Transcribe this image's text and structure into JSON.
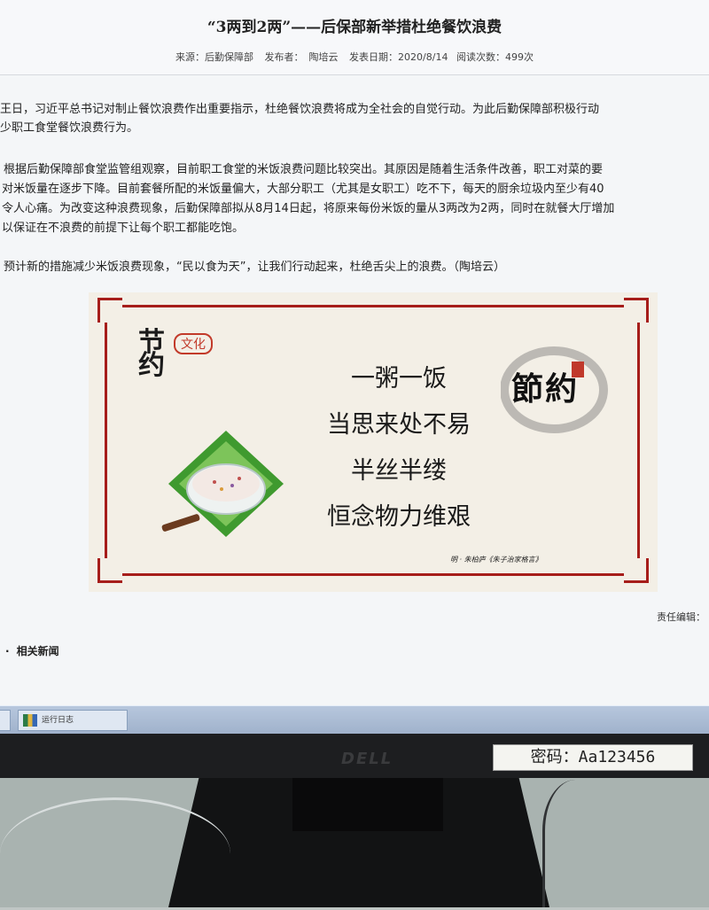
{
  "article": {
    "title": "“3两到2两”——后保部新举措杜绝餐饮浪费",
    "meta": {
      "source": "来源：后勤保障部",
      "publisher": "发布者：",
      "publisher_name": "陶培云",
      "date": "发表日期：2020/8/14",
      "views": "阅读次数：499次"
    },
    "paragraphs": {
      "p1a": "王日，习近平总书记对制止餐饮浪费作出重要指示，杜绝餐饮浪费将成为全社会的自觉行动。为此后勤保障部积极行动",
      "p1b": "少职工食堂餐饮浪费行为。",
      "p2a": "根据后勤保障部食堂监管组观察，目前职工食堂的米饭浪费问题比较突出。其原因是随着生活条件改善，职工对菜的要",
      "p2b": "对米饭量在逐步下降。目前套餐所配的米饭量偏大，大部分职工（尤其是女职工）吃不下，每天的厨余垃圾内至少有40",
      "p2c": "令人心痛。为改变这种浪费现象，后勤保障部拟从8月14日起，将原来每份米饭的量从3两改为2两，同时在就餐大厅增加",
      "p2d": "以保证在不浪费的前提下让每个职工都能吃饱。",
      "p3": "预计新的措施减少米饭浪费现象，“民以食为天”，让我们行动起来，杜绝舌尖上的浪费。（陶培云）"
    },
    "editor_label": "责任编辑：",
    "related_label": "相关新闻"
  },
  "poster": {
    "logo_main": "节约",
    "logo_sub": "文化",
    "lines": [
      "一粥一饭",
      "当思来处不易",
      "半丝半缕",
      "恒念物力维艰"
    ],
    "credit": "明 · 朱柏庐《朱子治家格言》",
    "seal": "節約",
    "colors": {
      "frame": "#a61d1a",
      "background": "#f3efe6"
    }
  },
  "taskbar": {
    "item_label": "运行日志"
  },
  "monitor": {
    "password_label": "密码：Aa123456"
  }
}
